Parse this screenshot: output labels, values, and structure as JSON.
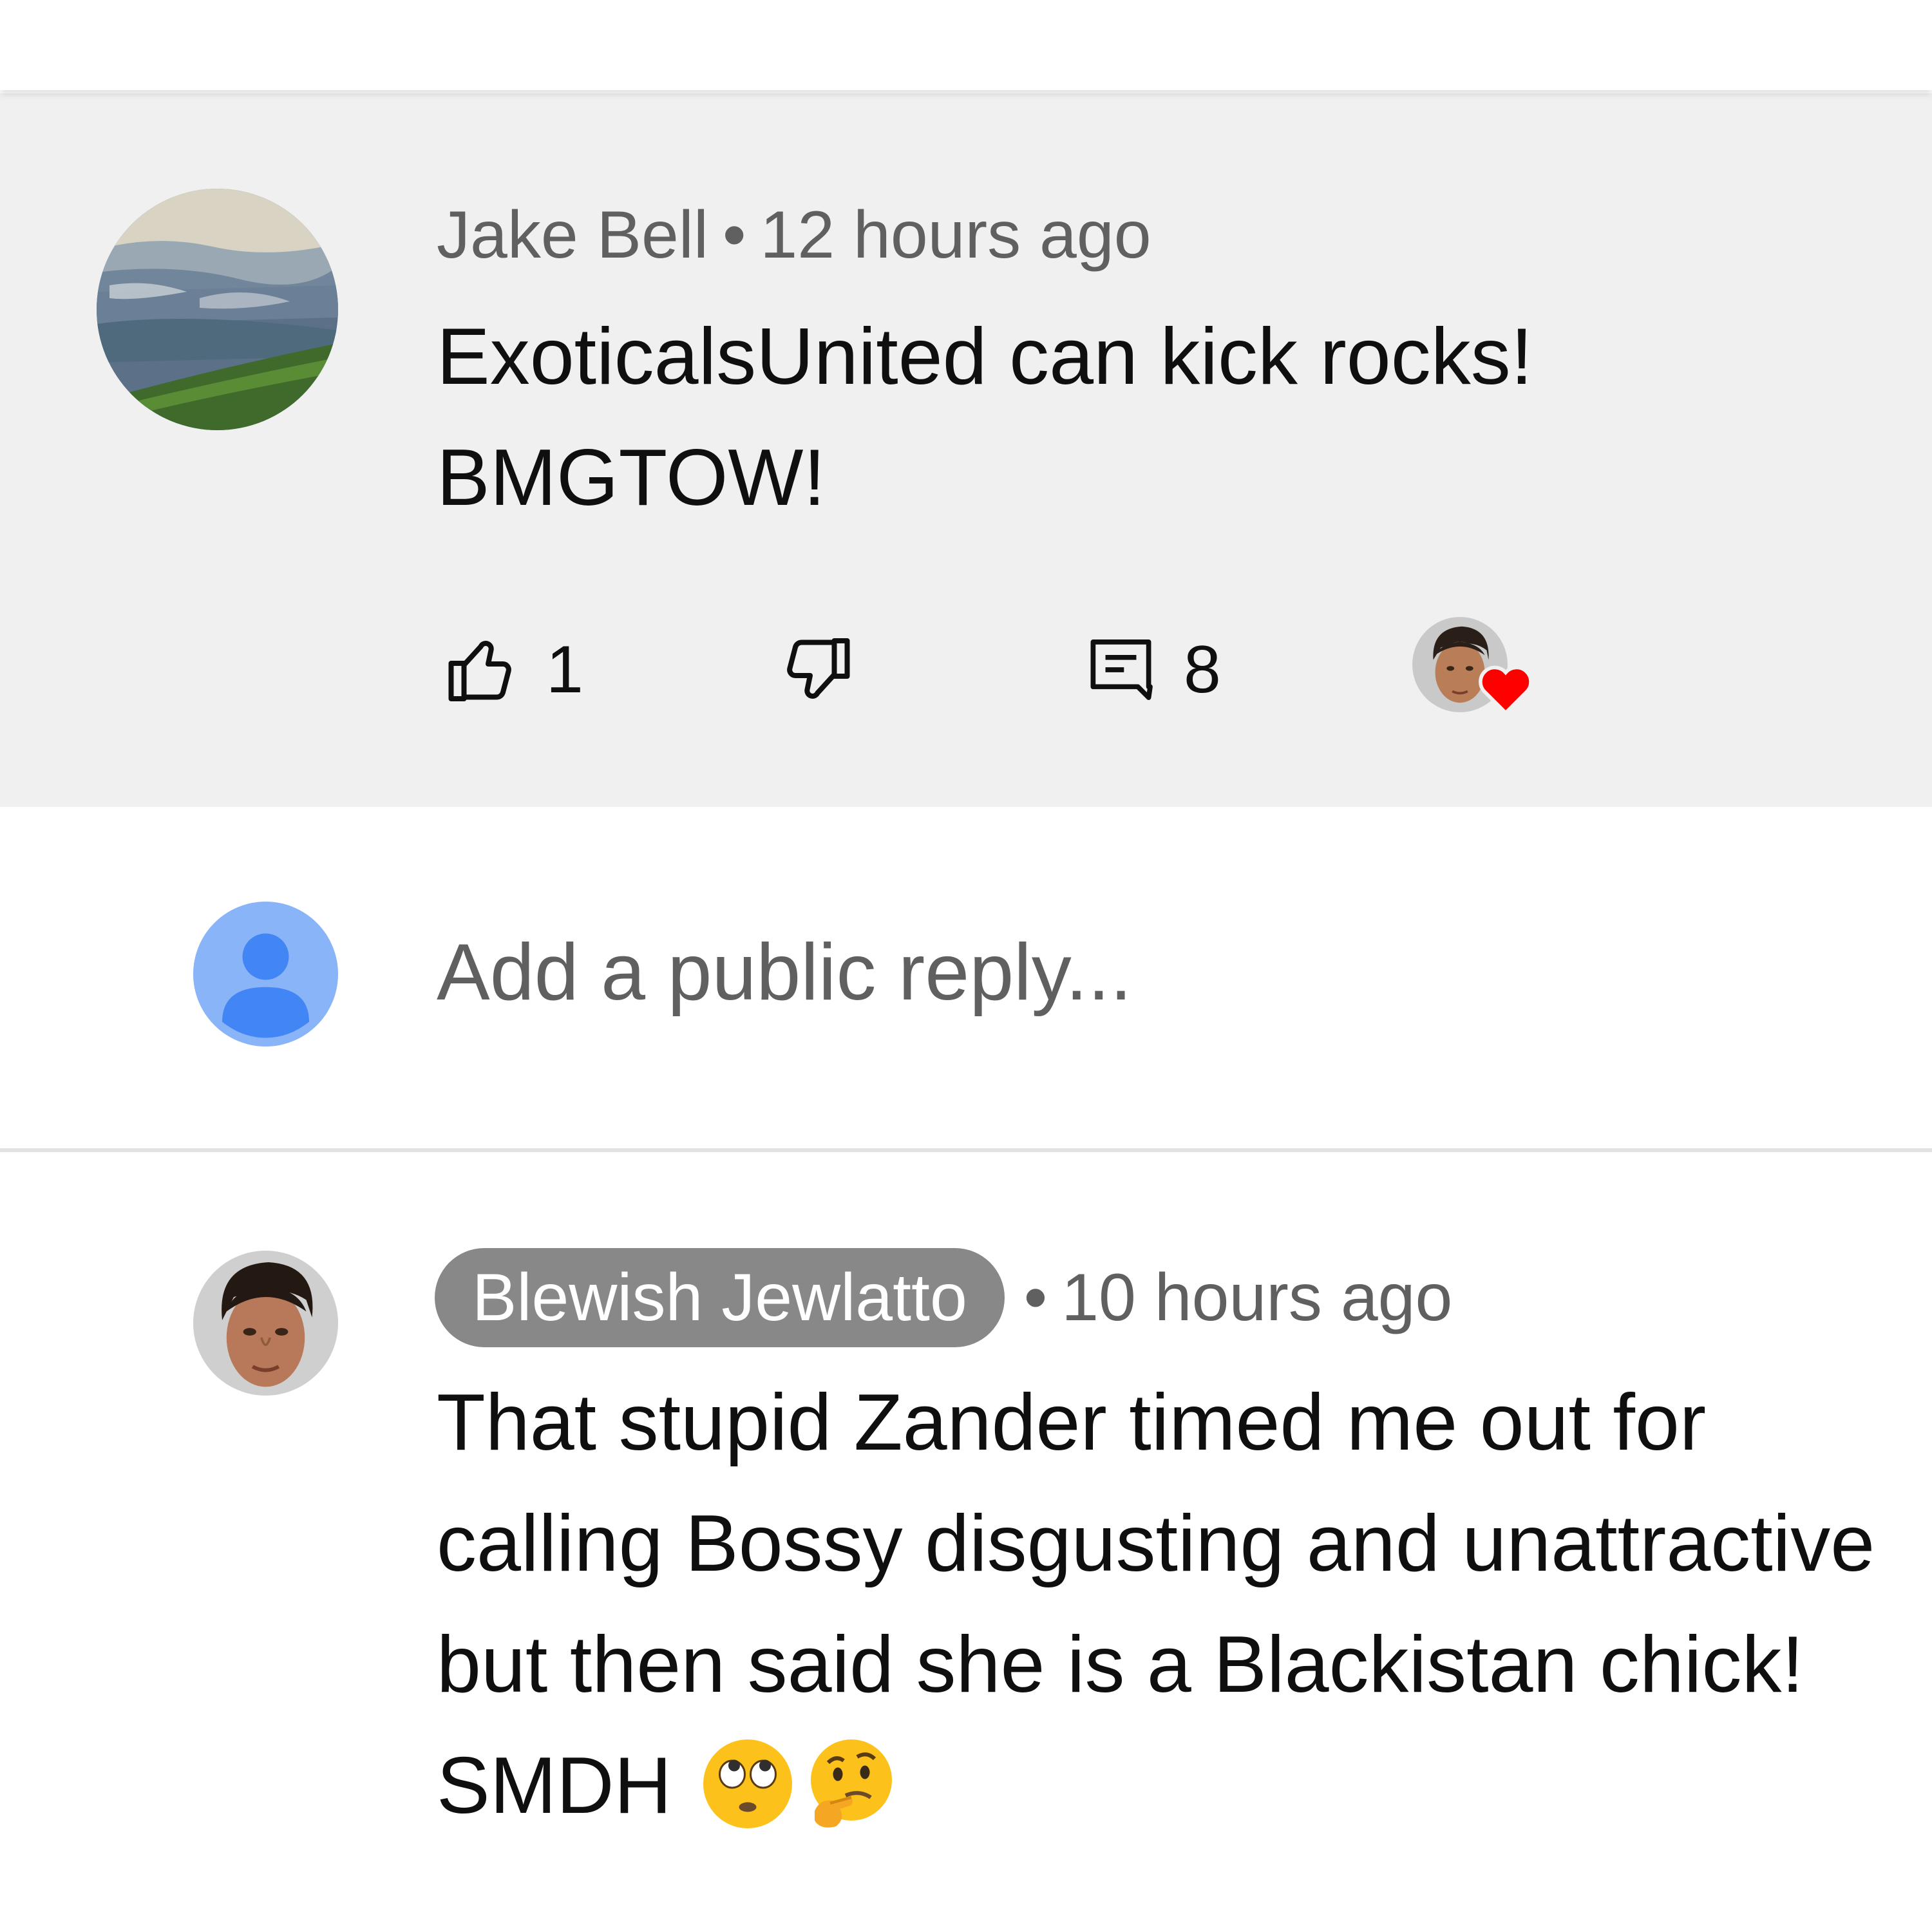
{
  "comments": [
    {
      "author": "Jake Bell",
      "separator": "•",
      "time": "12 hours ago",
      "text": "ExoticalsUnited can kick rocks! BMGTOW!",
      "like_count": "1",
      "reply_count": "8"
    },
    {
      "author": "Blewish Jewlatto",
      "separator": "•",
      "time": "10 hours ago",
      "text": "That stupid Zander timed me out for calling Bossy disgusting and unattractive but then said she is a Blackistan chick! SMDH",
      "emojis": [
        "face-with-rolling-eyes",
        "thinking-face"
      ]
    }
  ],
  "reply": {
    "placeholder": "Add a public reply..."
  },
  "colors": {
    "highlight_bg": "#f0f0f0",
    "badge_bg": "#888888",
    "heart": "#ff0000",
    "default_avatar_bg": "#8ab4f8",
    "default_avatar_fg": "#4285f4"
  }
}
